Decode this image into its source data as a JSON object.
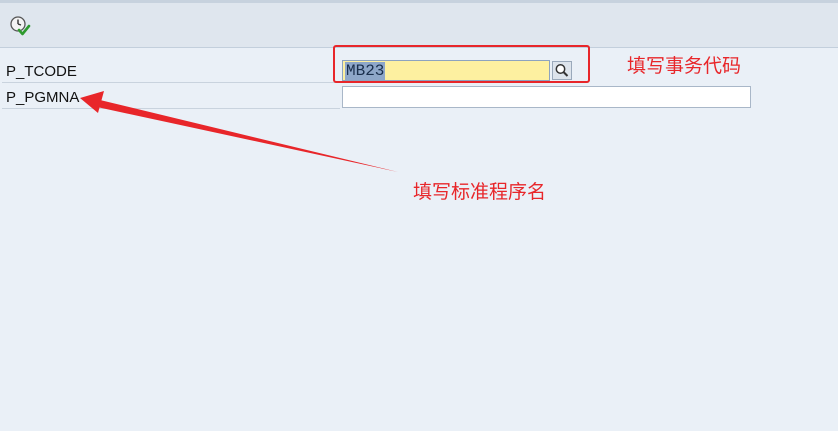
{
  "toolbar": {
    "execute_icon": "execute-clock-check-icon"
  },
  "fields": [
    {
      "label": "P_TCODE",
      "value": "MB23",
      "state": "selected"
    },
    {
      "label": "P_PGMNA",
      "value": "",
      "state": "empty"
    }
  ],
  "search_help_icon": "magnifier-icon",
  "annotations": {
    "tcode_note": "填写事务代码",
    "pgmna_note": "填写标准程序名"
  },
  "colors": {
    "annotation": "#e8262a",
    "input_focus_bg": "#fdf0a0",
    "selection": "#8ea7c9",
    "background": "#eaf0f7"
  }
}
